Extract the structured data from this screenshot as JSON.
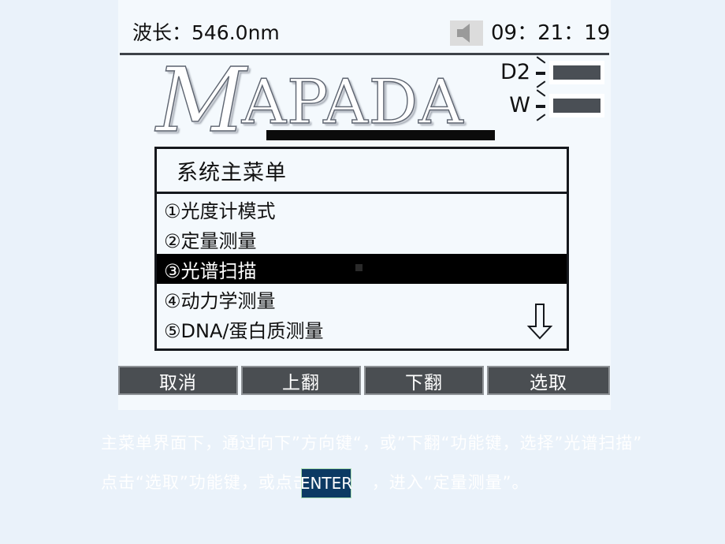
{
  "status_bar": {
    "wavelength": "波长：546.0nm",
    "speaker_icon": "speaker-muted-icon",
    "time": "09：21：19"
  },
  "brand": {
    "wordmark_lead": "M",
    "wordmark_rest": "APADA"
  },
  "lamps": [
    {
      "label": "D2",
      "state_icon": "lamp-on-icon"
    },
    {
      "label": "W",
      "state_icon": "lamp-on-icon"
    }
  ],
  "menu": {
    "title": "系统主菜单",
    "items": [
      {
        "label": "①光度计模式",
        "selected": false
      },
      {
        "label": "②定量测量",
        "selected": false
      },
      {
        "label": "③光谱扫描",
        "selected": true
      },
      {
        "label": "④动力学测量",
        "selected": false
      },
      {
        "label": "⑤DNA/蛋白质测量",
        "selected": false
      }
    ],
    "scroll_icon": "arrow-down-icon"
  },
  "function_buttons": [
    {
      "label": "取消"
    },
    {
      "label": "上翻"
    },
    {
      "label": "下翻"
    },
    {
      "label": "选取"
    }
  ],
  "caption": {
    "line1": "主菜单界面下，通过向下”方向键“，或”下翻“功能键，选择”光谱扫描”",
    "line2_before": "点击“选取”功能键，或点击",
    "enter_key": "ENTER",
    "line2_after": "，进入“定量测量”。"
  },
  "colors": {
    "page_background": "#eaf2fa",
    "panel_background": "#f4f9fd",
    "selection_background": "#000000",
    "button_background": "#4a4e52",
    "lamp_bar": "#4a4f55",
    "enter_badge_background": "#0c3a63",
    "enter_badge_border": "#a8dcb0",
    "text_dark": "#111111",
    "caption_text": "#ffffff"
  }
}
